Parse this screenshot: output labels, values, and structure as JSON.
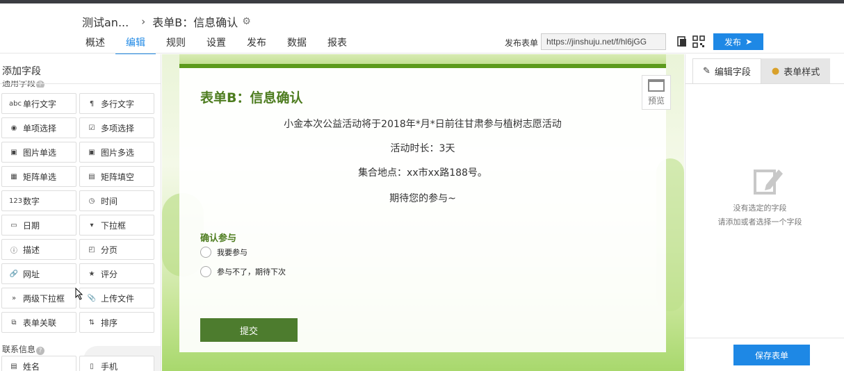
{
  "header": {
    "breadcrumb_app": "测试an...",
    "breadcrumb_form": "表单B：信息确认",
    "tabs": [
      "概述",
      "编辑",
      "规则",
      "设置",
      "发布",
      "数据",
      "报表"
    ],
    "active_tab": "编辑",
    "publish_label": "发布表单",
    "publish_url": "https://jinshuju.net/f/hl6jGG",
    "publish_button": "发布"
  },
  "sidebar": {
    "title": "添加字段",
    "group_general": "通用字段",
    "fields": [
      {
        "label": "单行文字",
        "icon": "abc"
      },
      {
        "label": "多行文字",
        "icon": "¶"
      },
      {
        "label": "单项选择",
        "icon": "◉"
      },
      {
        "label": "多项选择",
        "icon": "☑"
      },
      {
        "label": "图片单选",
        "icon": "▣"
      },
      {
        "label": "图片多选",
        "icon": "▣"
      },
      {
        "label": "矩阵单选",
        "icon": "▦"
      },
      {
        "label": "矩阵填空",
        "icon": "▤"
      },
      {
        "label": "数字",
        "icon": "123"
      },
      {
        "label": "时间",
        "icon": "◷"
      },
      {
        "label": "日期",
        "icon": "▭"
      },
      {
        "label": "下拉框",
        "icon": "▾"
      },
      {
        "label": "描述",
        "icon": "ⓘ"
      },
      {
        "label": "分页",
        "icon": "◰"
      },
      {
        "label": "网址",
        "icon": "🔗"
      },
      {
        "label": "评分",
        "icon": "★"
      },
      {
        "label": "两级下拉框",
        "icon": "»"
      },
      {
        "label": "上传文件",
        "icon": "📎"
      },
      {
        "label": "表单关联",
        "icon": "⧉"
      },
      {
        "label": "排序",
        "icon": "⇅"
      }
    ],
    "group_contact": "联系信息",
    "contact_fields": [
      {
        "label": "姓名",
        "icon": "▤"
      },
      {
        "label": "手机",
        "icon": "▯"
      }
    ]
  },
  "form": {
    "title": "表单B：信息确认",
    "description": [
      "小金本次公益活动将于2018年*月*日前往甘肃参与植树志愿活动",
      "活动时长：3天",
      "集合地点：xx市xx路188号。",
      "期待您的参与~"
    ],
    "question_label": "确认参与",
    "options": [
      "我要参与",
      "参与不了，期待下次"
    ],
    "submit_label": "提交",
    "preview_label": "预览"
  },
  "right_panel": {
    "tab_edit_field": "编辑字段",
    "tab_form_style": "表单样式",
    "empty_title": "没有选定的字段",
    "empty_hint": "请添加或者选择一个字段",
    "save_button": "保存表单"
  },
  "colors": {
    "accent": "#1e88e5",
    "form_green": "#4d7c1f",
    "submit_green": "#4d7c2e"
  }
}
